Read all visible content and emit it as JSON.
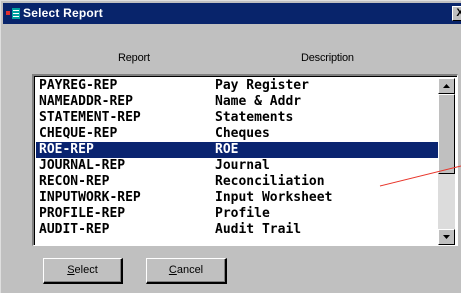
{
  "window": {
    "title": "Select Report",
    "close_label": "X"
  },
  "columns": {
    "report": "Report",
    "description": "Description"
  },
  "rows": [
    {
      "report": "PAYREG-REP",
      "description": "Pay Register"
    },
    {
      "report": "NAMEADDR-REP",
      "description": "Name & Addr"
    },
    {
      "report": "STATEMENT-REP",
      "description": "Statements"
    },
    {
      "report": "CHEQUE-REP",
      "description": "Cheques"
    },
    {
      "report": "ROE-REP",
      "description": "ROE",
      "selected": true
    },
    {
      "report": "JOURNAL-REP",
      "description": "Journal"
    },
    {
      "report": "RECON-REP",
      "description": "Reconciliation"
    },
    {
      "report": "INPUTWORK-REP",
      "description": "Input Worksheet"
    },
    {
      "report": "PROFILE-REP",
      "description": "Profile"
    },
    {
      "report": "AUDIT-REP",
      "description": "Audit Trail"
    }
  ],
  "buttons": {
    "select": {
      "accel": "S",
      "rest": "elect"
    },
    "cancel": {
      "accel": "C",
      "rest": "ancel"
    }
  },
  "colors": {
    "title_bar": "#08246b",
    "selection": "#0a2470",
    "annotation_line": "#e8352a"
  },
  "icons": [
    "app-icon",
    "close-icon",
    "scroll-up-arrow-icon",
    "scroll-down-arrow-icon"
  ]
}
